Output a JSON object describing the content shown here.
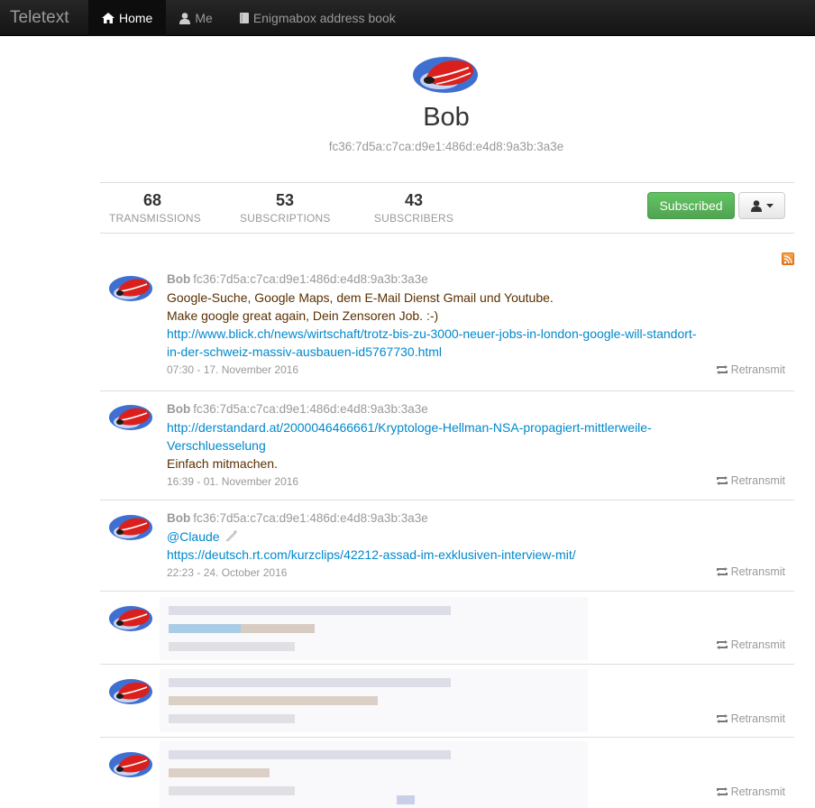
{
  "navbar": {
    "brand": "Teletext",
    "items": [
      {
        "label": "Home",
        "icon": "home-icon",
        "active": true
      },
      {
        "label": "Me",
        "icon": "user-icon",
        "active": false
      },
      {
        "label": "Enigmabox address book",
        "icon": "book-icon",
        "active": false
      }
    ]
  },
  "profile": {
    "name": "Bob",
    "address": "fc36:7d5a:c7ca:d9e1:486d:e4d8:9a3b:3a3e"
  },
  "stats": {
    "transmissions": {
      "value": "68",
      "label": "TRANSMISSIONS"
    },
    "subscriptions": {
      "value": "53",
      "label": "SUBSCRIPTIONS"
    },
    "subscribers": {
      "value": "43",
      "label": "SUBSCRIBERS"
    },
    "subscribed_label": "Subscribed"
  },
  "posts": [
    {
      "author": "Bob",
      "address": "fc36:7d5a:c7ca:d9e1:486d:e4d8:9a3b:3a3e",
      "lines": [
        "Google-Suche, Google Maps, dem E-Mail Dienst Gmail und Youtube.",
        "Make google great again, Dein Zensoren Job. :-)"
      ],
      "link": "http://www.blick.ch/news/wirtschaft/trotz-bis-zu-3000-neuer-jobs-in-london-google-will-standort-in-der-schweiz-massiv-ausbauen-id5767730.html",
      "link_lines": [
        "http://www.blick.ch/news/wirtschaft/trotz-bis-zu-3000-neuer-jobs-in-london-google-will-standort-",
        "in-der-schweiz-massiv-ausbauen-id5767730.html"
      ],
      "timestamp": "07:30 - 17. November 2016",
      "retransmit": "Retransmit"
    },
    {
      "author": "Bob",
      "address": "fc36:7d5a:c7ca:d9e1:486d:e4d8:9a3b:3a3e",
      "link_lines": [
        "http://derstandard.at/2000046466661/Kryptologe-Hellman-NSA-propagiert-mittlerweile-",
        "Verschluesselung"
      ],
      "lines": [
        "Einfach mitmachen."
      ],
      "timestamp": "16:39 - 01. November 2016",
      "retransmit": "Retransmit"
    },
    {
      "author": "Bob",
      "address": "fc36:7d5a:c7ca:d9e1:486d:e4d8:9a3b:3a3e",
      "mention": "@Claude",
      "link_lines": [
        "https://deutsch.rt.com/kurzclips/42212-assad-im-exklusiven-interview-mit/"
      ],
      "timestamp": "22:23 - 24. October 2016",
      "retransmit": "Retransmit"
    },
    {
      "retransmit": "Retransmit"
    },
    {
      "retransmit": "Retransmit"
    },
    {
      "retransmit": "Retransmit"
    }
  ],
  "colors": {
    "link": "#0088cc",
    "post_text": "#5a3000",
    "muted": "#999999",
    "subscribed_green": "#51a351"
  }
}
